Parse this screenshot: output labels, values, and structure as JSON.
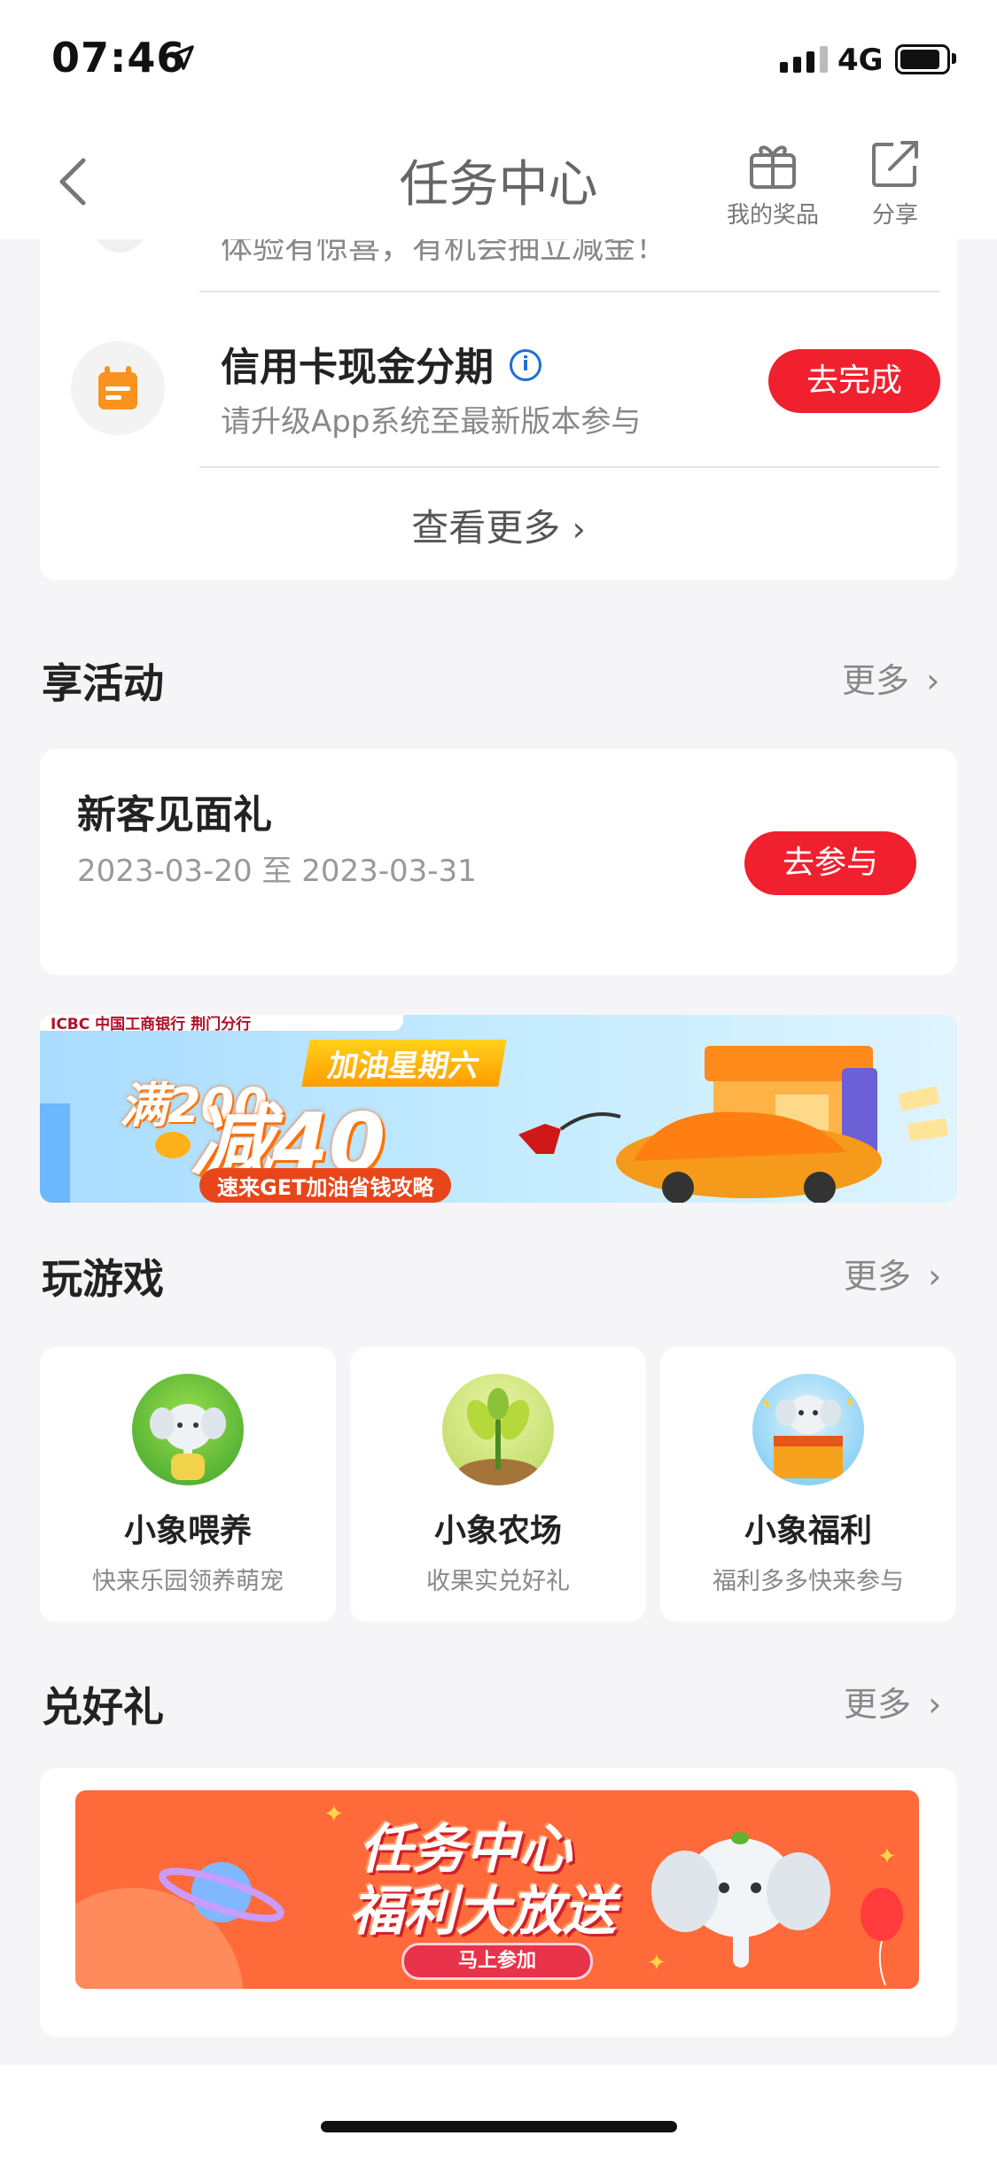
{
  "status_bar": {
    "time": "07:46",
    "network": "4G"
  },
  "nav": {
    "title": "任务中心",
    "prizes_label": "我的奖品",
    "share_label": "分享"
  },
  "tasks": {
    "partial_subtitle": "体验有惊喜，有机会抽立减金！",
    "items": [
      {
        "title": "信用卡现金分期",
        "subtitle": "请升级App系统至最新版本参与",
        "button": "去完成"
      }
    ],
    "see_more": "查看更多"
  },
  "activities": {
    "title": "享活动",
    "more": "更多",
    "item": {
      "title": "新客见面礼",
      "date_range": "2023-03-20 至 2023-03-31",
      "button": "去参与"
    }
  },
  "banner_fuel": {
    "bank_name": "ICBC 中国工商银行 荆门分行",
    "headline": "加油星期六",
    "offer_full": "满200",
    "offer_minus": "减40",
    "cta": "速来GET加油省钱攻略"
  },
  "games": {
    "title": "玩游戏",
    "more": "更多",
    "items": [
      {
        "name": "小象喂养",
        "sub": "快来乐园领养萌宠"
      },
      {
        "name": "小象农场",
        "sub": "收果实兑好礼"
      },
      {
        "name": "小象福利",
        "sub": "福利多多快来参与"
      }
    ]
  },
  "gifts": {
    "title": "兑好礼",
    "more": "更多",
    "banner": {
      "line1": "任务中心",
      "line2": "福利大放送",
      "cta": "马上参加"
    }
  },
  "colors": {
    "accent_red": "#f0202e",
    "orange": "#ff6a3a",
    "task_icon": "#f7931e"
  }
}
